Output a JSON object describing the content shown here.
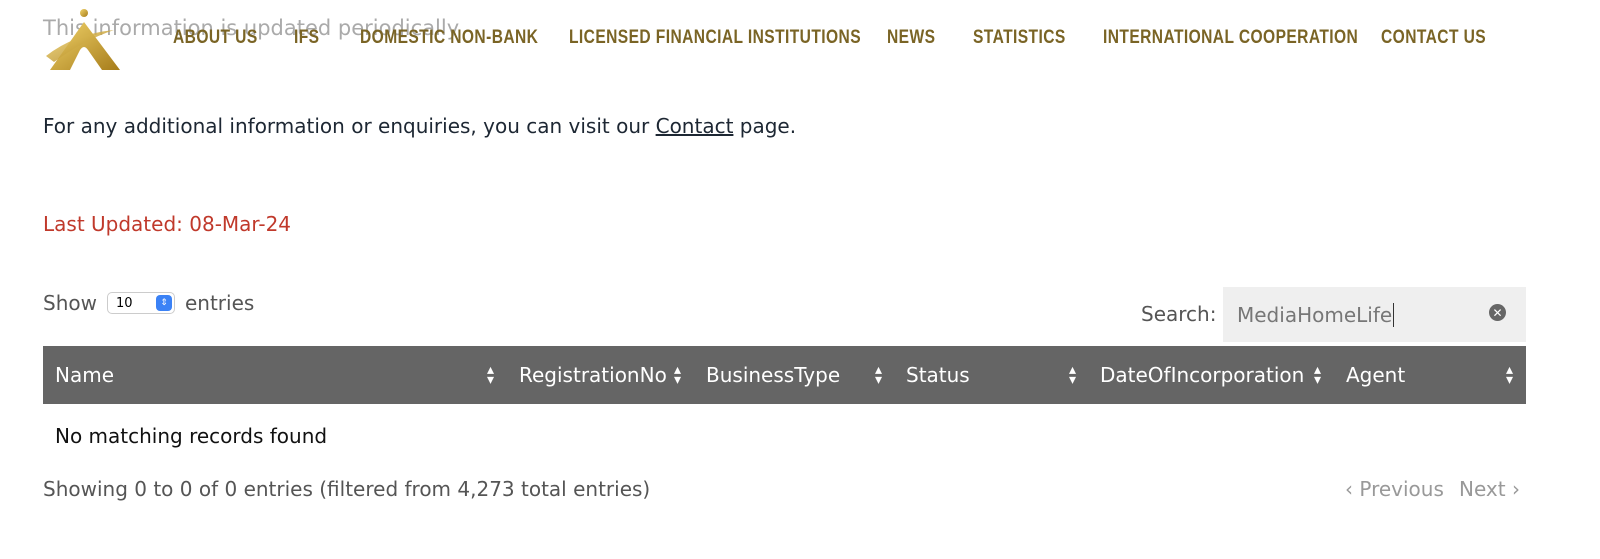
{
  "header": {
    "faded_notice": "This information is updated periodically",
    "logo_color": "#c9a227",
    "nav": [
      {
        "label": "ABOUT US"
      },
      {
        "label": "IFS"
      },
      {
        "label": "DOMESTIC NON-BANK"
      },
      {
        "label": "LICENSED FINANCIAL INSTITUTIONS"
      },
      {
        "label": "NEWS"
      },
      {
        "label": "STATISTICS"
      },
      {
        "label": "INTERNATIONAL COOPERATION"
      },
      {
        "label": "CONTACT US"
      }
    ]
  },
  "content": {
    "info_prefix": "For any additional information or enquiries, you can visit our ",
    "info_link": "Contact",
    "info_suffix": " page.",
    "last_updated": "Last Updated:  08-Mar-24"
  },
  "table": {
    "show_label": "Show",
    "entries_value": "10",
    "entries_label": "entries",
    "search_label": "Search:",
    "search_value": "MediaHomeLife",
    "columns": [
      "Name",
      "RegistrationNo",
      "BusinessType",
      "Status",
      "DateOfIncorporation",
      "Agent"
    ],
    "empty_message": "No matching records found",
    "info": "Showing 0 to 0 of 0 entries (filtered from 4,273 total entries)",
    "previous": "Previous",
    "next": "Next",
    "header_color": "#656565"
  }
}
